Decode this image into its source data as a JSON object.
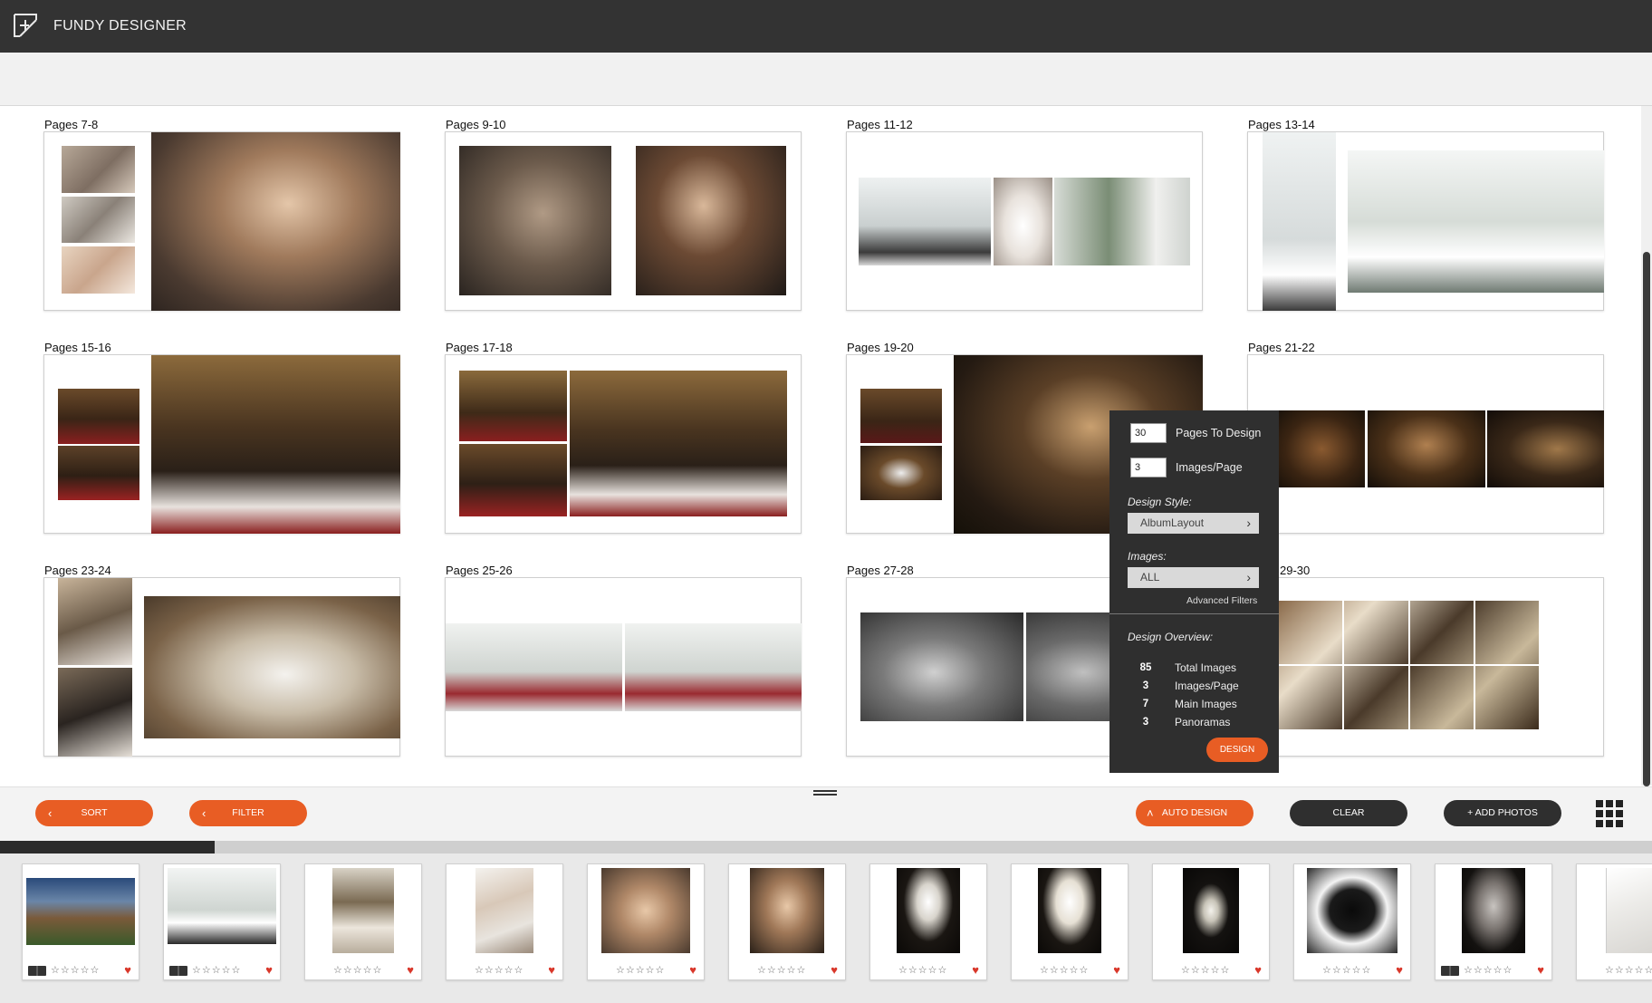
{
  "app": {
    "title": "FUNDY DESIGNER",
    "logo_icon": "fundy-logo-icon"
  },
  "spreads": [
    {
      "label": "Pages 7-8"
    },
    {
      "label": "Pages 9-10"
    },
    {
      "label": "Pages 11-12"
    },
    {
      "label": "Pages 13-14"
    },
    {
      "label": "Pages 15-16"
    },
    {
      "label": "Pages 17-18"
    },
    {
      "label": "Pages 19-20"
    },
    {
      "label": "Pages 21-22"
    },
    {
      "label": "Pages 23-24"
    },
    {
      "label": "Pages 25-26"
    },
    {
      "label": "Pages 27-28"
    },
    {
      "label": "29-30"
    }
  ],
  "design_panel": {
    "pages_to_design_value": "30",
    "pages_to_design_label": "Pages To Design",
    "images_per_page_value": "3",
    "images_per_page_label": "Images/Page",
    "design_style_label": "Design Style:",
    "design_style_value": "AlbumLayout",
    "images_label": "Images:",
    "images_value": "ALL",
    "advanced_filters": "Advanced Filters",
    "overview_label": "Design Overview:",
    "overview": [
      {
        "num": "85",
        "label": "Total Images"
      },
      {
        "num": "3",
        "label": "Images/Page"
      },
      {
        "num": "7",
        "label": "Main Images"
      },
      {
        "num": "3",
        "label": "Panoramas"
      }
    ],
    "design_button": "DESIGN"
  },
  "toolbar": {
    "sort": "SORT",
    "filter": "FILTER",
    "auto_design": "AUTO DESIGN",
    "clear": "CLEAR",
    "add_photos": "+ ADD PHOTOS"
  },
  "filmstrip": {
    "stars": "☆☆☆☆☆",
    "heart": "♥",
    "progress": 0.13
  },
  "colors": {
    "accent": "#e85d24",
    "dark": "#2f2f2f",
    "topbar": "#333333",
    "heart": "#d9372a"
  }
}
